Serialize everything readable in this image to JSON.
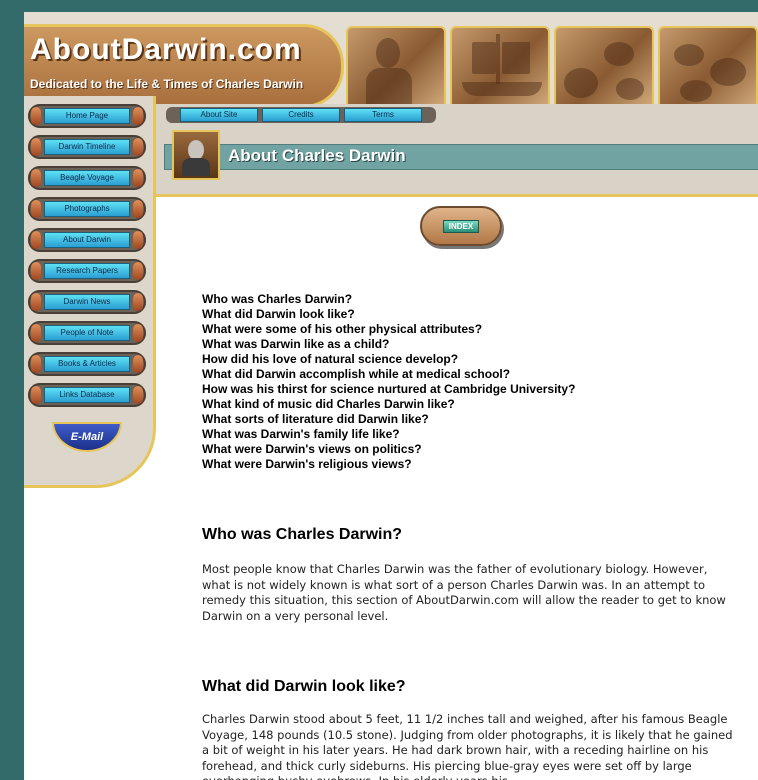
{
  "site": {
    "title": "AboutDarwin.com",
    "tagline": "Dedicated to the Life & Times of Charles Darwin"
  },
  "photos": [
    "darwin-portrait",
    "beagle-ship",
    "galapagos-animals",
    "finch-sketch"
  ],
  "sidebar": {
    "items": [
      {
        "label": "Home Page"
      },
      {
        "label": "Darwin Timeline"
      },
      {
        "label": "Beagle Voyage"
      },
      {
        "label": "Photographs"
      },
      {
        "label": "About Darwin"
      },
      {
        "label": "Research Papers"
      },
      {
        "label": "Darwin News"
      },
      {
        "label": "People of Note"
      },
      {
        "label": "Books & Articles"
      },
      {
        "label": "Links Database"
      }
    ],
    "email_label": "E-Mail"
  },
  "tabs": [
    {
      "label": "About Site"
    },
    {
      "label": "Credits"
    },
    {
      "label": "Terms"
    }
  ],
  "section": {
    "title": "About Charles Darwin"
  },
  "index_label": "INDEX",
  "questions": [
    "Who was Charles Darwin?",
    "What did Darwin look like?",
    "What were some of his other physical attributes?",
    "What was Darwin like as a child?",
    "How did his love of natural science develop?",
    "What did Darwin accomplish while at medical school?",
    "How was his thirst for science nurtured at Cambridge University?",
    "What kind of music did Charles Darwin like?",
    "What sorts of literature did Darwin like?",
    "What was Darwin's family life like?",
    "What were Darwin's views on politics?",
    "What were Darwin's religious views?"
  ],
  "articles": [
    {
      "heading": "Who was Charles Darwin?",
      "body": "Most people know that Charles Darwin was the father of evolutionary biology. However, what is not widely known is what sort of a person Charles Darwin was. In an attempt to remedy this situation, this section of AboutDarwin.com will allow the reader to get to know Darwin on a very personal level."
    },
    {
      "heading": "What did Darwin look like?",
      "body": "Charles Darwin stood about 5 feet, 11 1/2 inches tall and weighed, after his famous Beagle Voyage, 148 pounds (10.5 stone). Judging from older photographs, it is likely that he gained a bit of weight in his later years. He had dark brown hair, with a receding hairline on his forehead, and thick curly sideburns. His piercing blue-gray eyes were set off by large overhanging bushy eyebrows. In his elderly years his"
    }
  ],
  "colors": {
    "teal": "#336b6b",
    "gold": "#e6c65a",
    "titlebar": "#72a3a3",
    "button_cyan": "#5ee0f4"
  }
}
